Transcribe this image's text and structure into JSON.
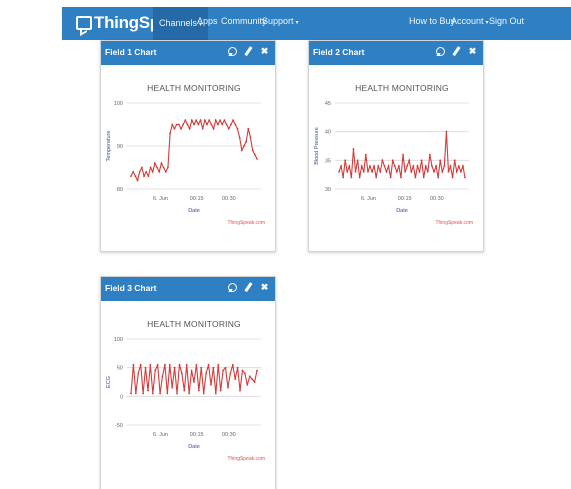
{
  "navbar": {
    "brand": "ThingSpeak",
    "brand_tm": "TM",
    "items": [
      {
        "label": "Channels",
        "caret": "▾"
      },
      {
        "label": "Apps"
      },
      {
        "label": "Community"
      },
      {
        "label": "Support",
        "caret": "▾"
      }
    ],
    "right_items": [
      {
        "label": "How to Buy"
      },
      {
        "label": "Account",
        "caret": "▾"
      },
      {
        "label": "Sign Out"
      }
    ]
  },
  "colors": {
    "accent": "#2f7fc3",
    "series": "#d43a3a",
    "credit": "#d9534f"
  },
  "panels": [
    {
      "title": "Field 1 Chart",
      "icons": [
        "comment-icon",
        "edit-icon",
        "close-icon"
      ]
    },
    {
      "title": "Field 2 Chart",
      "icons": [
        "comment-icon",
        "edit-icon",
        "close-icon"
      ]
    },
    {
      "title": "Field 3 Chart",
      "icons": [
        "comment-icon",
        "edit-icon",
        "close-icon"
      ]
    }
  ],
  "close_glyph": "✖",
  "chart_data": [
    {
      "type": "line",
      "title": "HEALTH MONITORING",
      "xlabel": "Date",
      "ylabel": "Temperature",
      "credit": "ThingSpeak.com",
      "yticks": [
        "100",
        "90",
        "80"
      ],
      "ylim": [
        80,
        100
      ],
      "xticks": [
        "6. Jun",
        "00:15",
        "00:30"
      ],
      "grid": true,
      "series": [
        {
          "values": [
            83,
            84,
            83,
            82,
            84,
            85,
            83,
            84,
            83,
            85,
            84,
            86,
            85,
            84,
            86,
            85,
            84,
            85,
            93,
            95,
            94,
            95,
            95,
            94,
            95,
            96,
            95,
            94,
            96,
            95,
            96,
            95,
            96,
            94,
            96,
            95,
            96,
            95,
            94,
            96,
            95,
            96,
            95,
            96,
            95,
            94,
            95,
            96,
            95,
            94,
            92,
            89,
            90,
            91,
            94,
            92,
            89,
            88,
            87
          ]
        }
      ]
    },
    {
      "type": "line",
      "title": "HEALTH MONITORING",
      "xlabel": "Date",
      "ylabel": "Blood Pressure",
      "credit": "ThingSpeak.com",
      "yticks": [
        "45",
        "40",
        "35",
        "30"
      ],
      "ylim": [
        30,
        45
      ],
      "xticks": [
        "6. Jun",
        "00:15",
        "00:30"
      ],
      "grid": true,
      "series": [
        {
          "values": [
            33,
            34,
            32,
            35,
            33,
            34,
            32,
            37,
            33,
            35,
            32,
            34,
            33,
            36,
            33,
            34,
            33,
            34,
            32,
            34,
            33,
            35,
            34,
            33,
            34,
            32,
            35,
            34,
            33,
            34,
            32,
            36,
            33,
            34,
            35,
            33,
            34,
            32,
            34,
            33,
            35,
            32,
            34,
            33,
            36,
            34,
            33,
            34,
            32,
            35,
            33,
            34,
            40,
            33,
            34,
            32,
            35,
            33,
            34,
            33,
            34,
            32
          ]
        }
      ]
    },
    {
      "type": "line",
      "title": "HEALTH MONITORING",
      "xlabel": "Date",
      "ylabel": "ECG",
      "credit": "ThingSpeak.com",
      "yticks": [
        "100",
        "50",
        "0",
        "-50"
      ],
      "ylim": [
        -50,
        100
      ],
      "xticks": [
        "6. Jun",
        "00:15",
        "00:30"
      ],
      "grid": true,
      "series": [
        {
          "values": [
            5,
            55,
            5,
            40,
            55,
            5,
            50,
            10,
            55,
            5,
            45,
            55,
            5,
            35,
            55,
            5,
            55,
            15,
            50,
            5,
            55,
            40,
            10,
            55,
            5,
            45,
            25,
            55,
            10,
            50,
            5,
            40,
            55,
            20,
            50,
            5,
            55,
            10,
            45,
            50,
            15,
            40,
            55,
            30,
            50,
            10,
            45,
            40,
            20,
            35,
            30,
            25,
            45
          ]
        }
      ]
    }
  ]
}
